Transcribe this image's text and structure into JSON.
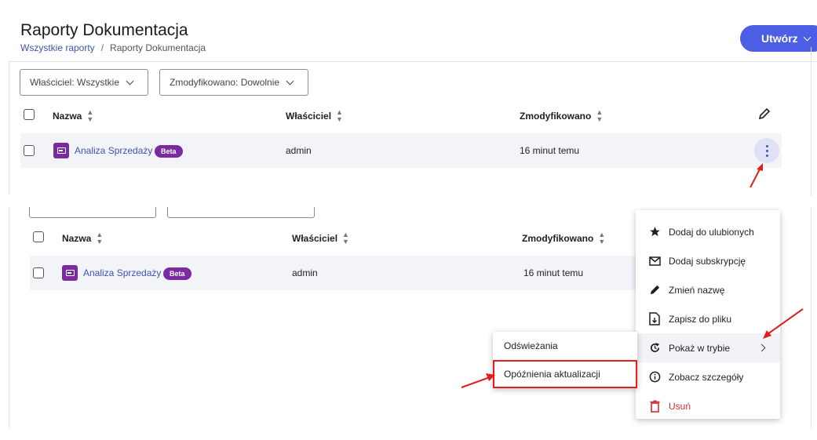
{
  "page": {
    "title": "Raporty Dokumentacja",
    "breadcrumb": [
      "Wszystkie raporty",
      "Raporty Dokumentacja"
    ],
    "breadcrumb_sep": "/",
    "create_button": "Utwórz"
  },
  "filters": {
    "owner": "Właściciel: Wszystkie",
    "modified": "Zmodyfikowano: Dowolnie"
  },
  "table": {
    "columns": [
      "Nazwa",
      "Właściciel",
      "Zmodyfikowano"
    ],
    "rows": [
      {
        "name": "Analiza Sprzedaży",
        "badge": "Beta",
        "owner": "admin",
        "modified": "16 minut temu"
      }
    ]
  },
  "context_menu": {
    "items": [
      {
        "label": "Dodaj do ulubionych",
        "icon": "star-icon"
      },
      {
        "label": "Dodaj subskrypcję",
        "icon": "mail-icon"
      },
      {
        "label": "Zmień nazwę",
        "icon": "pencil-icon"
      },
      {
        "label": "Zapisz do pliku",
        "icon": "file-download-icon"
      },
      {
        "label": "Pokaż w trybie",
        "icon": "refresh-icon",
        "has_submenu": true
      },
      {
        "label": "Zobacz szczegóły",
        "icon": "info-icon"
      },
      {
        "label": "Usuń",
        "icon": "trash-icon",
        "danger": true
      }
    ]
  },
  "submenu": {
    "items": [
      "Odświeżania",
      "Opóźnienia aktualizacji"
    ],
    "highlighted": "Opóźnienia aktualizacji"
  },
  "colors": {
    "accent": "#4b5ee4",
    "link": "#3f51b5",
    "badge": "#7b2aa0",
    "annotation": "#e02020",
    "danger": "#d32f2f"
  }
}
